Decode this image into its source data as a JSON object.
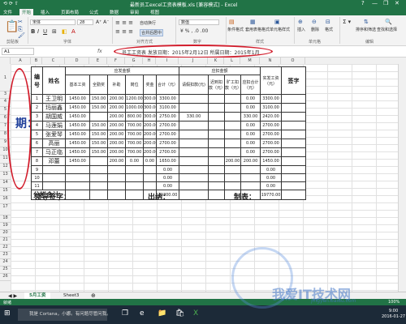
{
  "window": {
    "title": "最新员工excel工资表模板.xls [兼容模式] - Excel",
    "quick_access": "⟲ ⟳ ⇧",
    "controls": [
      "?",
      "—",
      "❐",
      "✕"
    ]
  },
  "tabs": [
    "文件",
    "开始",
    "插入",
    "页面布局",
    "公式",
    "数据",
    "审阅",
    "视图"
  ],
  "active_tab": "开始",
  "ribbon": {
    "font_name": "宋体",
    "font_size": "28",
    "number_format": "数值",
    "wrap_label": "自动换行",
    "merge_label": "合并后居中",
    "cond_format": "条件格式",
    "table_format": "套用表格格式",
    "cell_style": "单元格样式",
    "insert": "插入",
    "delete": "删除",
    "format": "格式",
    "sort": "排序和筛选",
    "find": "查找和选择",
    "groups": [
      "剪贴板",
      "字体",
      "对齐方式",
      "数字",
      "样式",
      "单元格",
      "编辑"
    ]
  },
  "formula_bar": {
    "namebox": "A1",
    "fx": "fx",
    "text": "员工工资表  发放日期：2015年2月12日  所属日期：2015年1月"
  },
  "columns": [
    "A",
    "B",
    "C",
    "D",
    "E",
    "F",
    "G",
    "H",
    "I",
    "J",
    "K",
    "L",
    "M",
    "N",
    "O"
  ],
  "rows": [
    "1",
    "2",
    "3",
    "4",
    "5",
    "6",
    "7",
    "8",
    "9",
    "10",
    "11",
    "12",
    "13",
    "14",
    "15",
    "16",
    "17",
    "18",
    "19",
    "20",
    "21",
    "22",
    "23",
    "24",
    "25",
    "26"
  ],
  "left_text": "期：",
  "table": {
    "h_no": "编号",
    "h_name": "姓名",
    "h_should": "应发金额",
    "h_deduct": "应扣金额",
    "h_actual": "实发工资（元）",
    "h_sign": "签字",
    "sub": [
      "基本工资",
      "全勤奖",
      "补助",
      "岗位",
      "奖金",
      "合计（元）",
      "请假扣款(元)",
      "迟到扣款（元）",
      "旷工扣款（元）",
      "应扣合计（元）"
    ],
    "rows": [
      {
        "no": "1",
        "name": "王卫明",
        "v": [
          "1450.00",
          "150.00",
          "200.00",
          "1200.00",
          "300.00",
          "3300.00",
          "",
          "",
          "",
          "0.00",
          "3300.00"
        ]
      },
      {
        "no": "2",
        "name": "玛丽鑫",
        "v": [
          "1450.00",
          "150.00",
          "200.00",
          "1000.00",
          "300.00",
          "3100.00",
          "",
          "",
          "",
          "0.00",
          "3100.00"
        ]
      },
      {
        "no": "3",
        "name": "胡国威",
        "v": [
          "1450.00",
          "",
          "200.00",
          "800.00",
          "300.00",
          "2750.00",
          "330.00",
          "",
          "",
          "330.00",
          "2420.00"
        ]
      },
      {
        "no": "4",
        "name": "马莲娟",
        "v": [
          "1450.00",
          "150.00",
          "200.00",
          "700.00",
          "200.00",
          "2700.00",
          "",
          "",
          "",
          "0.00",
          "2700.00"
        ]
      },
      {
        "no": "5",
        "name": "张爱琴",
        "v": [
          "1450.00",
          "150.00",
          "200.00",
          "700.00",
          "200.00",
          "2700.00",
          "",
          "",
          "",
          "0.00",
          "2700.00"
        ]
      },
      {
        "no": "6",
        "name": "高丽",
        "v": [
          "1450.00",
          "150.00",
          "200.00",
          "700.00",
          "200.00",
          "2700.00",
          "",
          "",
          "",
          "0.00",
          "2700.00"
        ]
      },
      {
        "no": "7",
        "name": "马正临",
        "v": [
          "1450.00",
          "150.00",
          "200.00",
          "700.00",
          "200.00",
          "2700.00",
          "",
          "",
          "",
          "0.00",
          "2700.00"
        ]
      },
      {
        "no": "8",
        "name": "邓蕾",
        "v": [
          "1450.00",
          "",
          "200.00",
          "0.00",
          "0.00",
          "1650.00",
          "",
          "",
          "200.00",
          "200.00",
          "1450.00"
        ]
      },
      {
        "no": "9",
        "name": "",
        "v": [
          "",
          "",
          "",
          "",
          "",
          "0.00",
          "",
          "",
          "",
          "",
          "0.00"
        ]
      },
      {
        "no": "10",
        "name": "",
        "v": [
          "",
          "",
          "",
          "",
          "",
          "0.00",
          "",
          "",
          "",
          "",
          "0.00"
        ]
      },
      {
        "no": "11",
        "name": "",
        "v": [
          "",
          "",
          "",
          "",
          "",
          "0.00",
          "",
          "",
          "",
          "",
          "0.00"
        ]
      }
    ],
    "total_label": "分栏合计",
    "total_sum": "19300.00",
    "total_actual": "19770.00"
  },
  "signatures": {
    "leader": "领导签字：",
    "cashier": "出纳：",
    "maker": "制表："
  },
  "sheets": [
    "5月工资",
    "Sheet3"
  ],
  "status": {
    "ready": "就绪",
    "zoom": "100%"
  },
  "taskbar": {
    "search": "我是 Cortana，小娜。有问题尽管问我。",
    "time": "9:00",
    "date": "2016-01-27"
  },
  "watermark": {
    "main": "我爱IT技术网",
    "sub": "jingyan.baidu.com"
  },
  "colors": {
    "excel_green": "#217346",
    "oval_red": "#d21d2c"
  }
}
